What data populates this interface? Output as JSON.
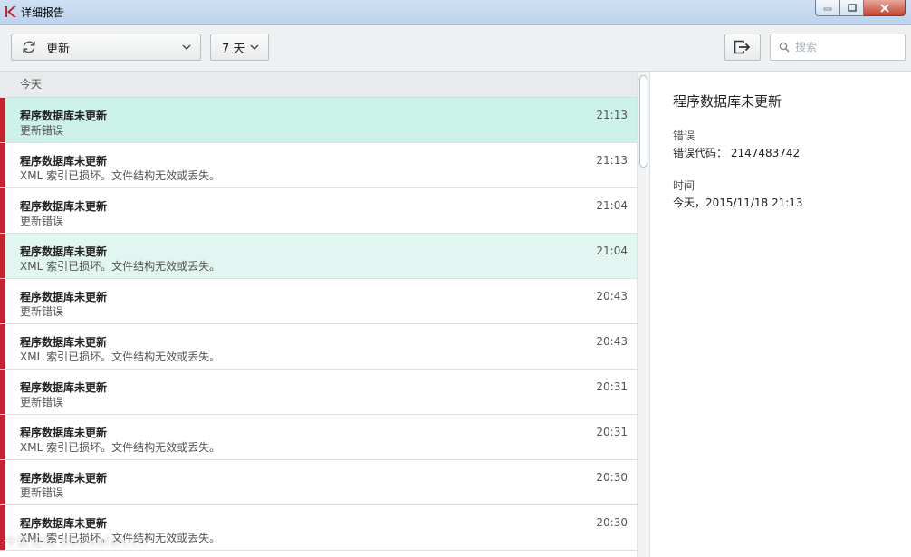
{
  "window": {
    "title": "详细报告",
    "icon": "kaspersky-k-logo",
    "controls": [
      "minimize-icon",
      "maximize-icon",
      "close-icon"
    ],
    "close_color": "#c4442f"
  },
  "toolbar": {
    "type_filter": {
      "icon": "refresh-icon",
      "label": "更新"
    },
    "period_filter": {
      "label": "7 天"
    },
    "export_icon": "export-icon",
    "search": {
      "placeholder": "搜索",
      "value": ""
    }
  },
  "list": {
    "group_label": "今天",
    "accent_color": "#c4232f",
    "selected_color": "#cdf2ea",
    "rows": [
      {
        "title": "程序数据库未更新",
        "desc": "更新错误",
        "time": "21:13",
        "state": "selected"
      },
      {
        "title": "程序数据库未更新",
        "desc": "XML 索引已损坏。文件结构无效或丢失。",
        "time": "21:13",
        "state": ""
      },
      {
        "title": "程序数据库未更新",
        "desc": "更新错误",
        "time": "21:04",
        "state": ""
      },
      {
        "title": "程序数据库未更新",
        "desc": "XML 索引已损坏。文件结构无效或丢失。",
        "time": "21:04",
        "state": "hover"
      },
      {
        "title": "程序数据库未更新",
        "desc": "更新错误",
        "time": "20:43",
        "state": ""
      },
      {
        "title": "程序数据库未更新",
        "desc": "XML 索引已损坏。文件结构无效或丢失。",
        "time": "20:43",
        "state": ""
      },
      {
        "title": "程序数据库未更新",
        "desc": "更新错误",
        "time": "20:31",
        "state": ""
      },
      {
        "title": "程序数据库未更新",
        "desc": "XML 索引已损坏。文件结构无效或丢失。",
        "time": "20:31",
        "state": ""
      },
      {
        "title": "程序数据库未更新",
        "desc": "更新错误",
        "time": "20:30",
        "state": ""
      },
      {
        "title": "程序数据库未更新",
        "desc": "XML 索引已损坏。文件结构无效或丢失。",
        "time": "20:30",
        "state": ""
      }
    ]
  },
  "detail": {
    "title": "程序数据库未更新",
    "status_label": "错误",
    "error_code": "错误代码： 2147483742",
    "time_label": "时间",
    "time_value": "今天，2015/11/18 21:13"
  },
  "watermark": "卡饭论坛 bbs.kafan.cn"
}
